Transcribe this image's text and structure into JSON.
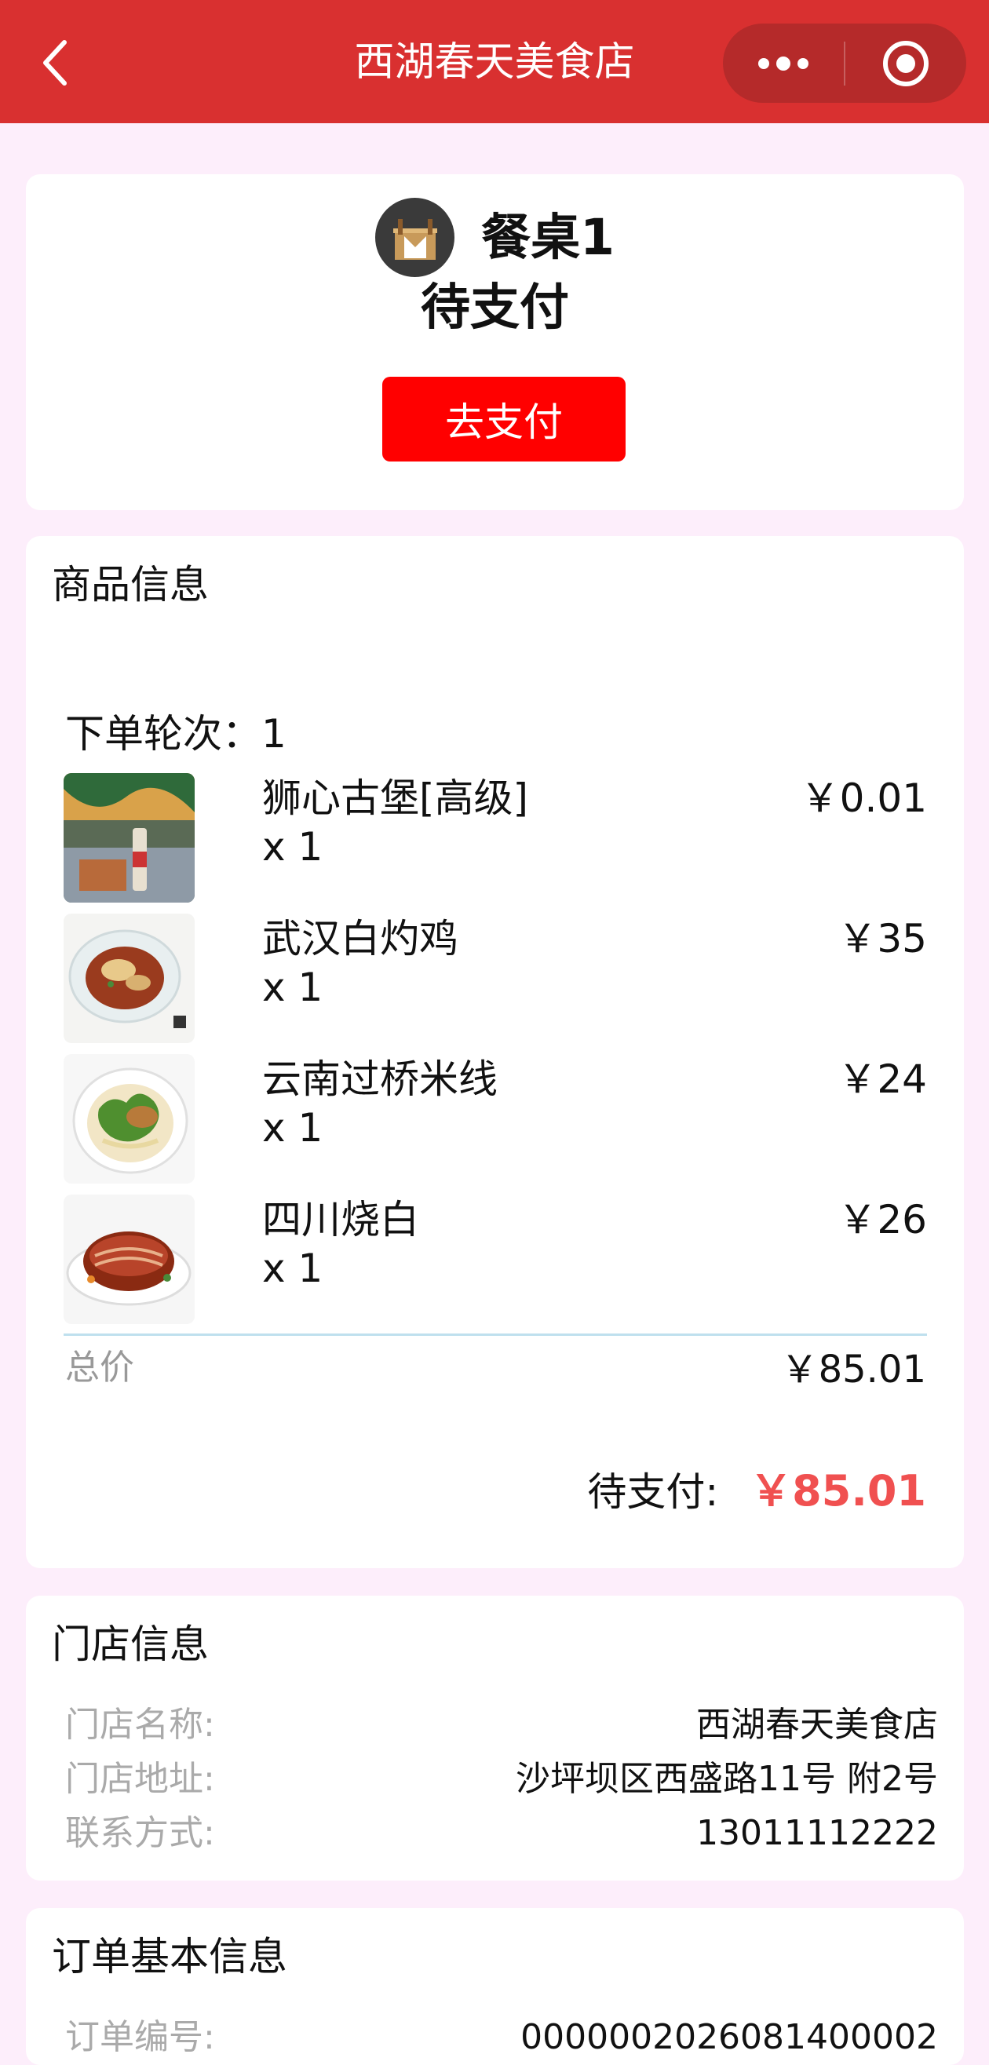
{
  "nav": {
    "title": "西湖春天美食店"
  },
  "status": {
    "table_name": "餐桌1",
    "status_text": "待支付",
    "pay_button": "去支付"
  },
  "goods": {
    "section_title": "商品信息",
    "round_label": "下单轮次：1",
    "items": [
      {
        "name": "狮心古堡[高级]",
        "qty": "x 1",
        "price": "￥0.01"
      },
      {
        "name": "武汉白灼鸡",
        "qty": "x 1",
        "price": "￥35"
      },
      {
        "name": "云南过桥米线",
        "qty": "x 1",
        "price": "￥24"
      },
      {
        "name": "四川烧白",
        "qty": "x 1",
        "price": "￥26"
      }
    ],
    "total_label": "总价",
    "total_value": "￥85.01",
    "pending_label": "待支付:",
    "pending_value": "￥85.01"
  },
  "store": {
    "section_title": "门店信息",
    "rows": [
      {
        "key": "门店名称:",
        "value": "西湖春天美食店"
      },
      {
        "key": "门店地址:",
        "value": "沙坪坝区西盛路11号 附2号"
      },
      {
        "key": "联系方式:",
        "value": "13011112222"
      }
    ]
  },
  "order": {
    "section_title": "订单基本信息",
    "rows": [
      {
        "key": "订单编号:",
        "value": "0000002026081400002"
      }
    ]
  },
  "colors": {
    "header_bg": "#d93030",
    "pay_button_bg": "#ff0000",
    "pending_price": "#f05050",
    "page_bg": "#fdeefb"
  }
}
